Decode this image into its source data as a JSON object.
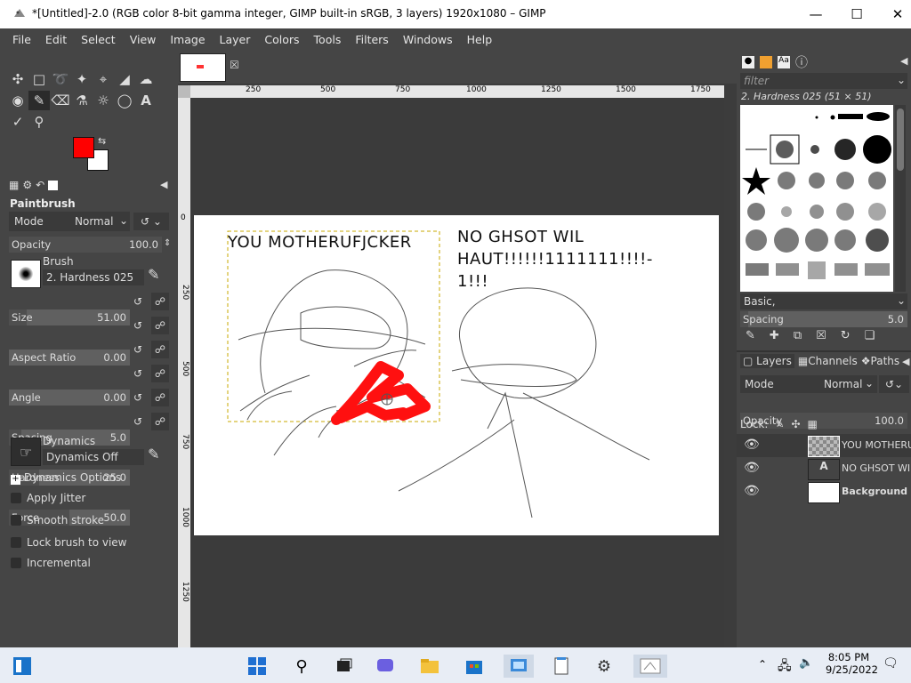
{
  "window": {
    "title": "*[Untitled]-2.0 (RGB color 8-bit gamma integer, GIMP built-in sRGB, 3 layers) 1920x1080 – GIMP"
  },
  "menu": [
    "File",
    "Edit",
    "Select",
    "View",
    "Image",
    "Layer",
    "Colors",
    "Tools",
    "Filters",
    "Windows",
    "Help"
  ],
  "colors": {
    "fg": "#ff0000",
    "bg": "#ffffff",
    "accent": "#ff0000"
  },
  "tool_options": {
    "title": "Paintbrush",
    "mode_label": "Mode",
    "mode_value": "Normal",
    "opacity_label": "Opacity",
    "opacity_value": "100.0",
    "brush_label": "Brush",
    "brush_value": "2. Hardness 025",
    "size_label": "Size",
    "size_value": "51.00",
    "aspect_label": "Aspect Ratio",
    "aspect_value": "0.00",
    "angle_label": "Angle",
    "angle_value": "0.00",
    "spacing_label": "Spacing",
    "spacing_value": "5.0",
    "hardness_label": "Hardness",
    "hardness_value": "25.0",
    "force_label": "Force",
    "force_value": "50.0",
    "dynamics_label": "Dynamics",
    "dynamics_value": "Dynamics Off",
    "dynamics_options": "Dynamics Options",
    "apply_jitter": "Apply Jitter",
    "smooth_stroke": "Smooth stroke",
    "lock_brush": "Lock brush to view",
    "incremental": "Incremental"
  },
  "ruler": {
    "h_ticks": [
      "250",
      "500",
      "750",
      "1000",
      "1250",
      "1500",
      "1750"
    ],
    "v_ticks": [
      "0",
      "250",
      "500",
      "750",
      "1000",
      "1250"
    ]
  },
  "canvas": {
    "text1": "YOU MOTHERUFJCKER",
    "text2_line1": "NO GHSOT WIL",
    "text2_line2": "HAUT!!!!!!1111111!!!!-",
    "text2_line3": "1!!!"
  },
  "brushes_panel": {
    "filter_placeholder": "filter",
    "selected_brush": "2. Hardness 025 (51 × 51)",
    "preset": "Basic,",
    "spacing_label": "Spacing",
    "spacing_value": "5.0"
  },
  "layers_panel": {
    "tabs": [
      "Layers",
      "Channels",
      "Paths"
    ],
    "mode_label": "Mode",
    "mode_value": "Normal",
    "opacity_label": "Opacity",
    "opacity_value": "100.0",
    "lock_label": "Lock:",
    "layers": [
      {
        "name": "YOU MOTHERUI"
      },
      {
        "name": "NO GHSOT WIL"
      },
      {
        "name": "Background"
      }
    ]
  },
  "taskbar": {
    "time": "8:05 PM",
    "date": "9/25/2022"
  }
}
